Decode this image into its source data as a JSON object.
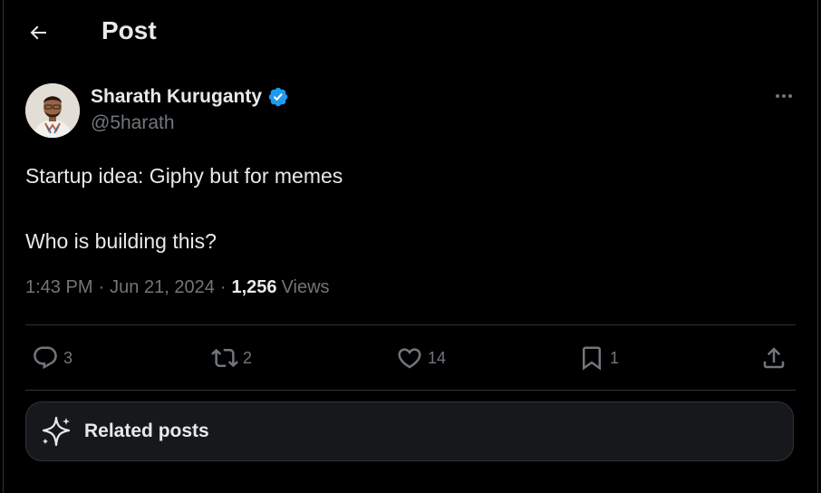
{
  "header": {
    "title": "Post",
    "back_icon": "arrow-left-icon"
  },
  "post": {
    "author": {
      "display_name": "Sharath Kuruganty",
      "handle": "@5harath",
      "verified": true,
      "verified_color": "#1d9bf0"
    },
    "text_lines": [
      "Startup idea: Giphy but for memes",
      "Who is building this?"
    ],
    "time": "1:43 PM",
    "separator": "·",
    "date": "Jun 21, 2024",
    "views_count": "1,256",
    "views_label": "Views"
  },
  "actions": {
    "reply": {
      "icon": "reply-icon",
      "count": "3"
    },
    "repost": {
      "icon": "repost-icon",
      "count": "2"
    },
    "like": {
      "icon": "heart-icon",
      "count": "14"
    },
    "bookmark": {
      "icon": "bookmark-icon",
      "count": "1"
    },
    "share": {
      "icon": "share-icon"
    }
  },
  "related": {
    "label": "Related posts",
    "icon": "sparkle-icon"
  },
  "colors": {
    "background": "#000000",
    "text_primary": "#e7e9ea",
    "text_secondary": "#71767b",
    "border": "#2f3336",
    "card_background": "#16181c",
    "accent": "#1d9bf0"
  }
}
